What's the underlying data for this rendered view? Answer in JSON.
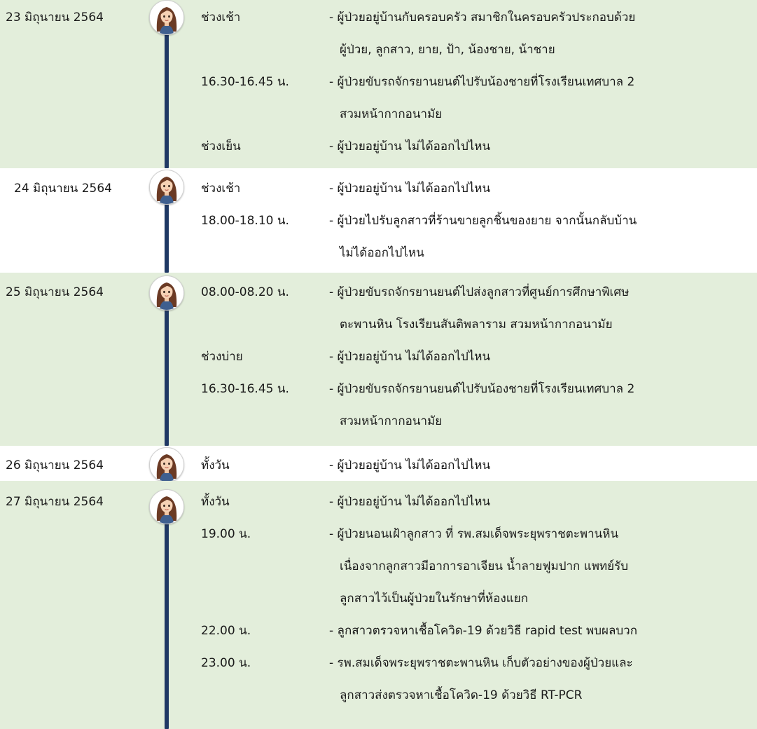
{
  "days": [
    {
      "date": "23 มิถุนายน 2564",
      "entries": [
        {
          "time": "ช่วงเช้า",
          "lines": [
            "- ผู้ป่วยอยู่บ้านกับครอบครัว สมาชิกในครอบครัวประกอบด้วย",
            "ผู้ป่วย, ลูกสาว, ยาย, ป้า, น้องชาย, น้าชาย"
          ]
        },
        {
          "time": "16.30-16.45 น.",
          "lines": [
            "- ผู้ป่วยขับรถจักรยานยนต์ไปรับน้องชายที่โรงเรียนเทศบาล 2",
            "สวมหน้ากากอนามัย"
          ]
        },
        {
          "time": "ช่วงเย็น",
          "lines": [
            "- ผู้ป่วยอยู่บ้าน ไม่ได้ออกไปไหน"
          ]
        }
      ]
    },
    {
      "date": "24 มิถุนายน 2564",
      "entries": [
        {
          "time": "ช่วงเช้า",
          "lines": [
            "- ผู้ป่วยอยู่บ้าน ไม่ได้ออกไปไหน"
          ]
        },
        {
          "time": "18.00-18.10 น.",
          "lines": [
            "- ผู้ป่วยไปรับลูกสาวที่ร้านขายลูกชิ้นของยาย จากนั้นกลับบ้าน",
            "ไม่ได้ออกไปไหน"
          ]
        }
      ]
    },
    {
      "date": "25 มิถุนายน 2564",
      "entries": [
        {
          "time": "08.00-08.20 น.",
          "lines": [
            "- ผู้ป่วยขับรถจักรยานยนต์ไปส่งลูกสาวที่ศูนย์การศึกษาพิเศษ",
            "ตะพานหิน โรงเรียนสันติพลาราม สวมหน้ากากอนามัย"
          ]
        },
        {
          "time": "ช่วงบ่าย",
          "lines": [
            "- ผู้ป่วยอยู่บ้าน ไม่ได้ออกไปไหน"
          ]
        },
        {
          "time": "16.30-16.45 น.",
          "lines": [
            "- ผู้ป่วยขับรถจักรยานยนต์ไปรับน้องชายที่โรงเรียนเทศบาล 2",
            "สวมหน้ากากอนามัย"
          ]
        }
      ]
    },
    {
      "date": "26 มิถุนายน 2564",
      "entries": [
        {
          "time": "ทั้งวัน",
          "lines": [
            "- ผู้ป่วยอยู่บ้าน ไม่ได้ออกไปไหน"
          ]
        }
      ]
    },
    {
      "date": "27 มิถุนายน 2564",
      "entries": [
        {
          "time": "ทั้งวัน",
          "lines": [
            "- ผู้ป่วยอยู่บ้าน ไม่ได้ออกไปไหน"
          ]
        },
        {
          "time": "19.00 น.",
          "lines": [
            "- ผู้ป่วยนอนเฝ้าลูกสาว ที่ รพ.สมเด็จพระยุพราชตะพานหิน",
            "เนื่องจากลูกสาวมีอาการอาเจียน น้ำลายฟูมปาก แพทย์รับ",
            "ลูกสาวไว้เป็นผู้ป่วยในรักษาที่ห้องแยก"
          ]
        },
        {
          "time": "22.00 น.",
          "lines": [
            "- ลูกสาวตรวจหาเชื้อโควิด-19 ด้วยวิธี rapid test พบผลบวก"
          ]
        },
        {
          "time": "23.00 น.",
          "lines": [
            "- รพ.สมเด็จพระยุพราชตะพานหิน เก็บตัวอย่างของผู้ป่วยและ",
            "ลูกสาวส่งตรวจหาเชื้อโควิด-19 ด้วยวิธี RT-PCR"
          ]
        }
      ]
    }
  ],
  "colors": {
    "green_band": "#e3eedb",
    "white_band": "#ffffff",
    "spine": "#1f3864",
    "text": "#1a1a1a"
  },
  "icons": {
    "avatar": "woman-avatar-icon"
  }
}
